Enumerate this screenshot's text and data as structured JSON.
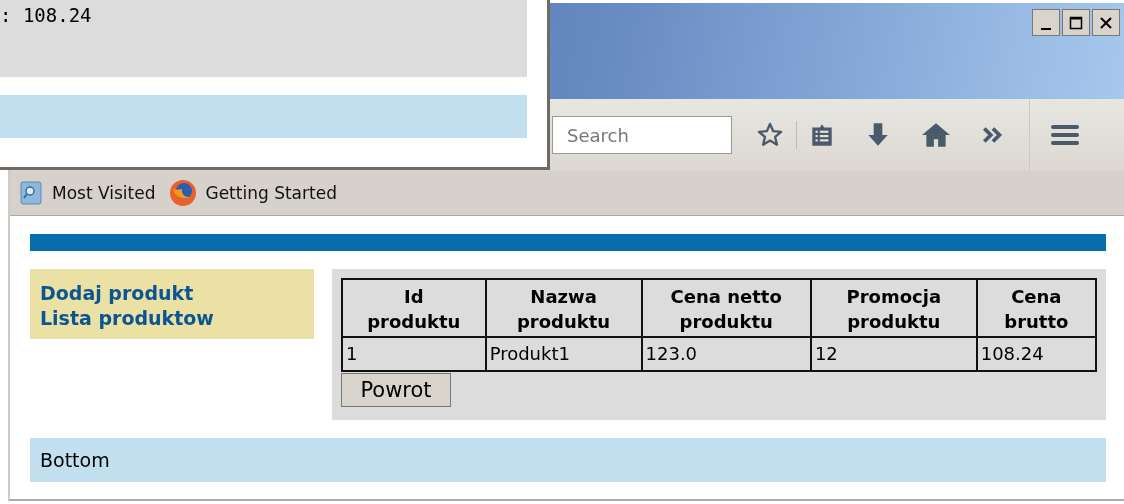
{
  "popup": {
    "text": ": 108.24"
  },
  "toolbar": {
    "search": {
      "placeholder": "Search"
    }
  },
  "bookmarks": [
    {
      "label": "Most Visited",
      "kind": "folder"
    },
    {
      "label": "Getting Started",
      "kind": "firefox"
    }
  ],
  "page": {
    "nav_links": [
      "Dodaj produkt",
      "Lista produktow"
    ],
    "table": {
      "columns": [
        "Id produktu",
        "Nazwa produktu",
        "Cena netto produktu",
        "Promocja produktu",
        "Cena brutto"
      ],
      "rows": [
        [
          "1",
          "Produkt1",
          "123.0",
          "12",
          "108.24"
        ]
      ]
    },
    "back_button": "Powrot",
    "footer": "Bottom"
  }
}
